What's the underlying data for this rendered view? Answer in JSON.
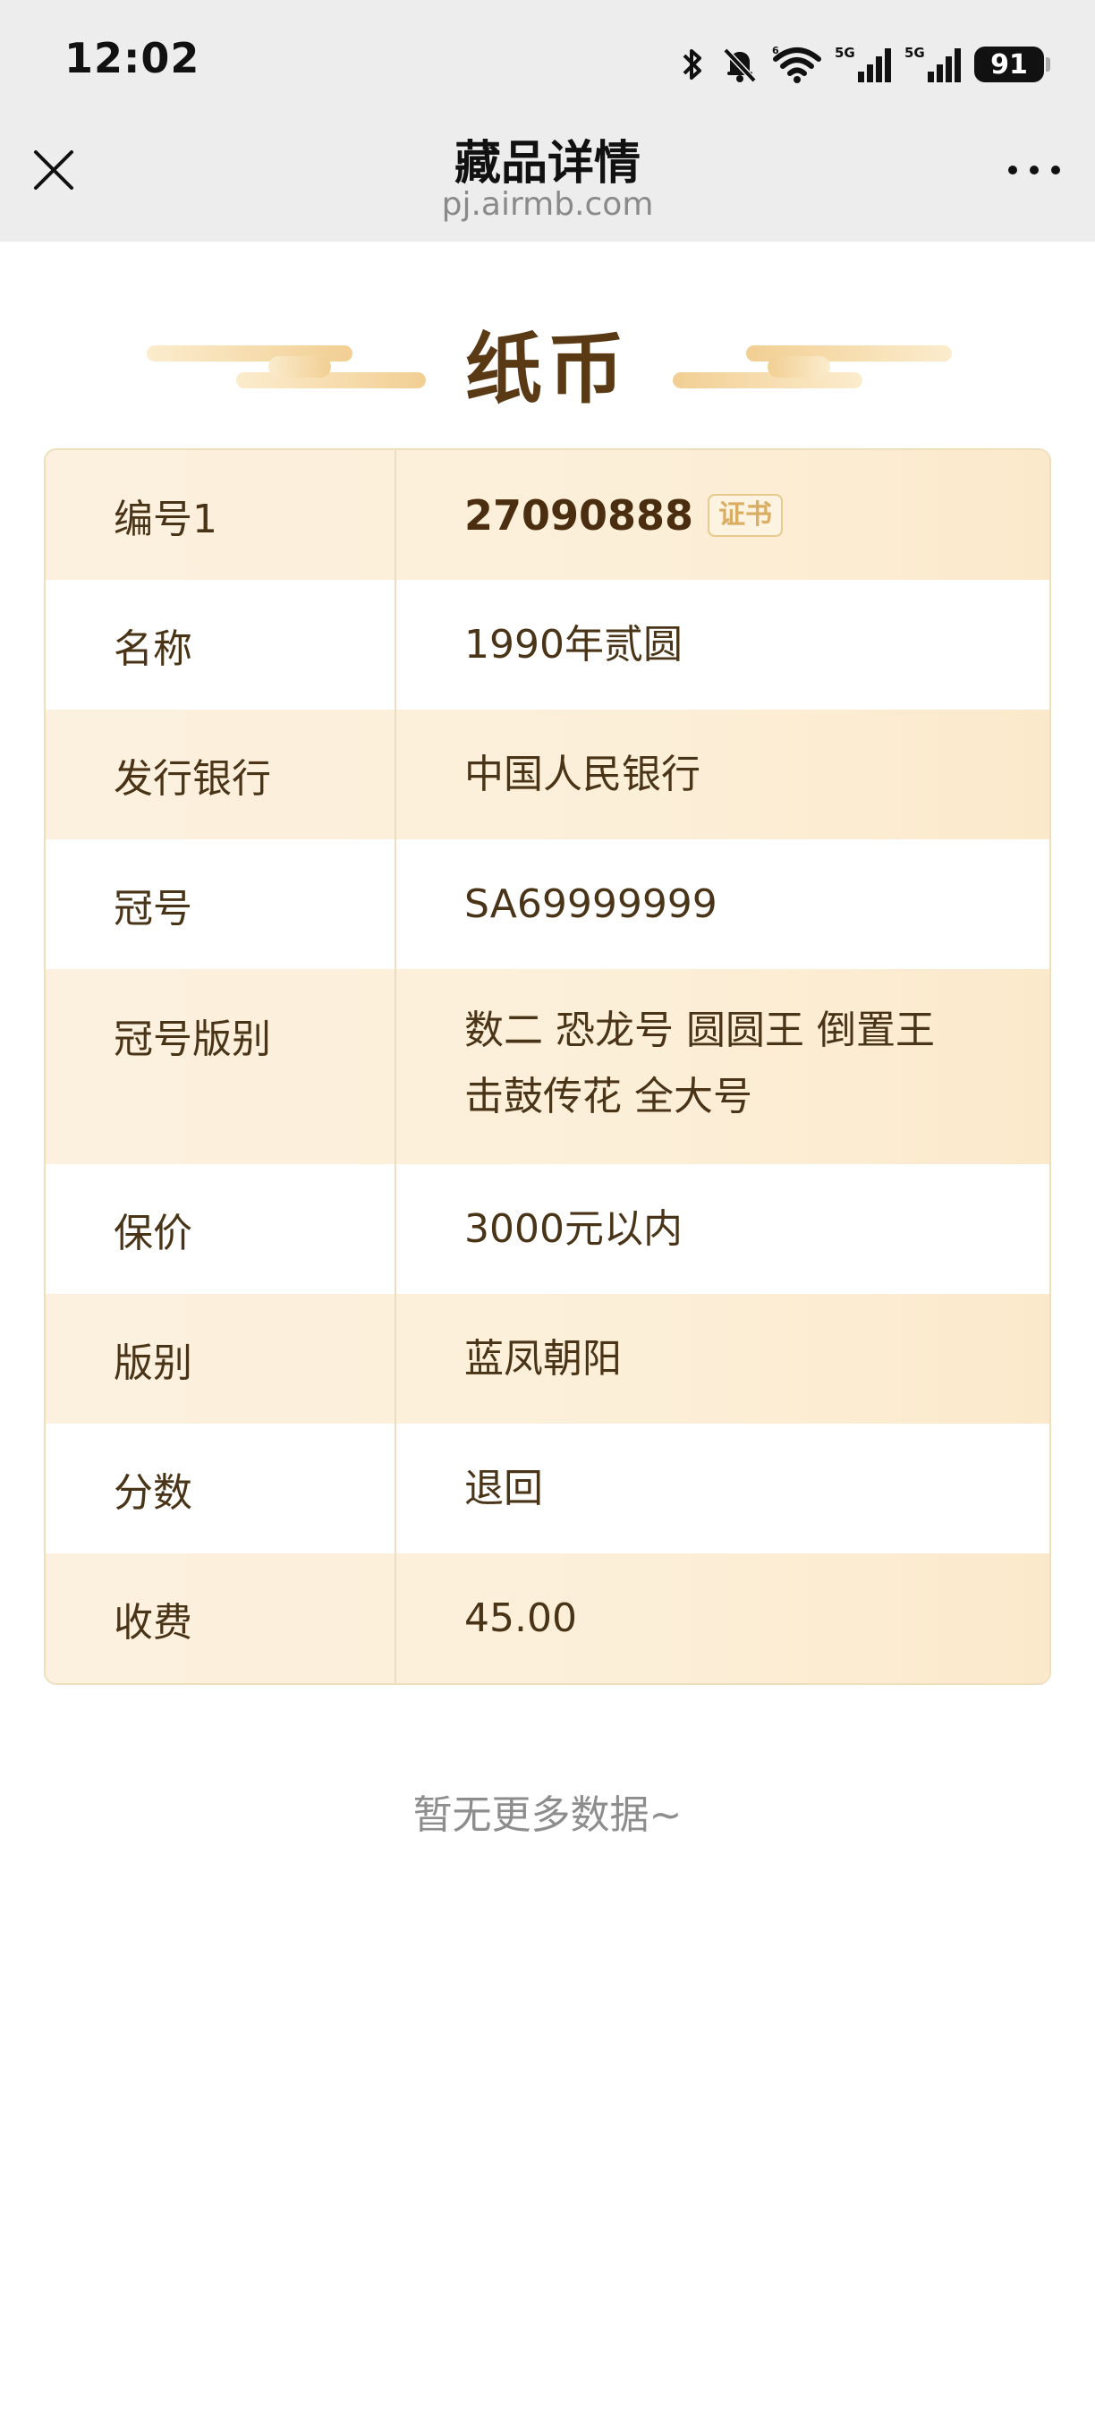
{
  "status_bar": {
    "time": "12:02",
    "battery": "91",
    "icons": [
      "bluetooth-icon",
      "mute-bell-icon",
      "wifi-icon",
      "signal-5g-icon",
      "signal-5g-icon",
      "battery-icon"
    ]
  },
  "nav": {
    "close_icon": "close-icon",
    "title": "藏品详情",
    "url": "pj.airmb.com",
    "more_icon": "more-dots-icon"
  },
  "heading": {
    "title": "纸币"
  },
  "details": {
    "serial_no": {
      "label": "编号1",
      "value": "27090888",
      "badge": "证书"
    },
    "name": {
      "label": "名称",
      "value": "1990年贰圆"
    },
    "bank": {
      "label": "发行银行",
      "value": "中国人民银行"
    },
    "crown": {
      "label": "冠号",
      "value": "SA69999999"
    },
    "crown_type": {
      "label": "冠号版别",
      "value_line1": "数二 恐龙号 圆圆王 倒置王",
      "value_line2": "击鼓传花 全大号"
    },
    "insured": {
      "label": "保价",
      "value": "3000元以内"
    },
    "edition": {
      "label": "版别",
      "value": "蓝凤朝阳"
    },
    "score": {
      "label": "分数",
      "value": "退回"
    },
    "fee": {
      "label": "收费",
      "value": "45.00"
    }
  },
  "footer": {
    "no_more": "暂无更多数据~"
  },
  "colors": {
    "header_bg": "#ededed",
    "row_alt": "#fcf1df",
    "border": "#f0dfbd",
    "text": "#4a3417",
    "badge": "#d9ad62"
  }
}
